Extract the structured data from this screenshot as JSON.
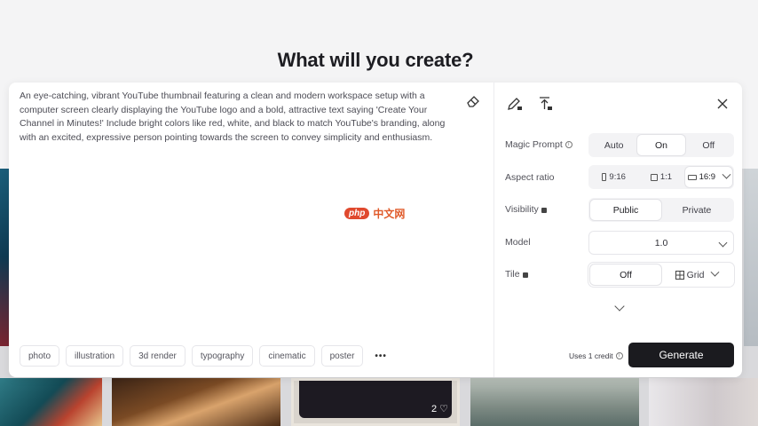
{
  "page": {
    "title": "What will you create?"
  },
  "prompt": {
    "text": "An eye-catching, vibrant YouTube thumbnail featuring a clean and modern workspace setup with a computer screen clearly displaying the YouTube logo and a bold, attractive text saying 'Create Your Channel in Minutes!' Include bright colors like red, white, and black to match YouTube's branding, along with an excited, expressive person pointing towards the screen to convey simplicity and enthusiasm."
  },
  "style_tags": [
    "photo",
    "illustration",
    "3d render",
    "typography",
    "cinematic",
    "poster"
  ],
  "more_label": "•••",
  "settings": {
    "magic_prompt": {
      "label": "Magic Prompt",
      "options": [
        "Auto",
        "On",
        "Off"
      ],
      "selected": "On"
    },
    "aspect_ratio": {
      "label": "Aspect ratio",
      "options": [
        "9:16",
        "1:1",
        "16:9"
      ],
      "selected": "16:9"
    },
    "visibility": {
      "label": "Visibility",
      "options": [
        "Public",
        "Private"
      ],
      "selected": "Public"
    },
    "model": {
      "label": "Model",
      "value": "1.0"
    },
    "tile": {
      "label": "Tile",
      "options": [
        "Off",
        "Grid"
      ],
      "selected": "Off"
    }
  },
  "footer": {
    "credit_text": "Uses 1 credit",
    "generate_label": "Generate"
  },
  "gallery": {
    "like_count": "2"
  },
  "watermark": {
    "logo": "php",
    "text": "中文网"
  },
  "colors": {
    "primary_button": "#1b1b1f",
    "panel_bg": "#ffffff",
    "page_bg": "#f3f3f4"
  }
}
